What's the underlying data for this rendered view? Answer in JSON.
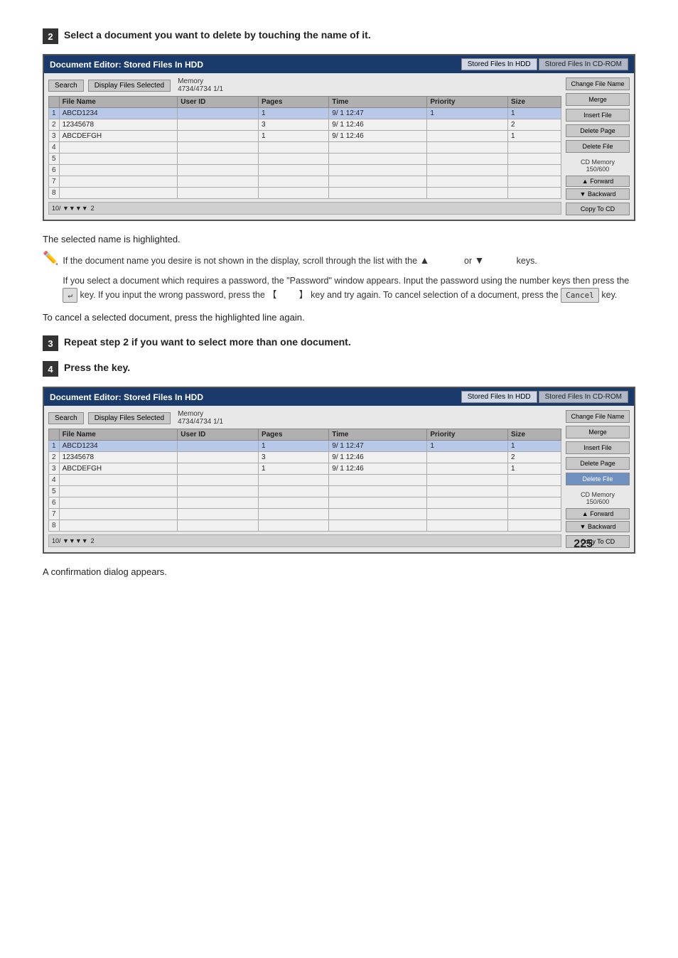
{
  "page": {
    "number": "225"
  },
  "step2": {
    "label": "2",
    "text": "Select a document you want to delete by touching the name of it."
  },
  "step3": {
    "label": "3",
    "text": "Repeat step 2 if you want to select more than one document."
  },
  "step4": {
    "label": "4",
    "text": "Press the                    key."
  },
  "editor1": {
    "title": "Document Editor: Stored Files In HDD",
    "tab1": "Stored Files In HDD",
    "tab2": "Stored Files In CD-ROM",
    "search_btn": "Search",
    "display_btn": "Display Files Selected",
    "memory_label": "Memory",
    "memory_used": "4734/",
    "memory_total": "4734",
    "page_info": "1/1",
    "columns": [
      "File Name",
      "User ID",
      "Pages",
      "Time",
      "Priority",
      "Size"
    ],
    "rows": [
      {
        "num": "1",
        "name": "ABCD1234",
        "user": "",
        "pages": "1",
        "time": "9/ 1 12:47",
        "priority": "1",
        "size": "1"
      },
      {
        "num": "2",
        "name": "12345678",
        "user": "",
        "pages": "3",
        "time": "9/ 1 12:46",
        "priority": "",
        "size": "2"
      },
      {
        "num": "3",
        "name": "ABCDEFGH",
        "user": "",
        "pages": "1",
        "time": "9/ 1 12:46",
        "priority": "",
        "size": "1"
      },
      {
        "num": "4",
        "name": "",
        "user": "",
        "pages": "",
        "time": "",
        "priority": "",
        "size": ""
      },
      {
        "num": "5",
        "name": "",
        "user": "",
        "pages": "",
        "time": "",
        "priority": "",
        "size": ""
      },
      {
        "num": "6",
        "name": "",
        "user": "",
        "pages": "",
        "time": "",
        "priority": "",
        "size": ""
      },
      {
        "num": "7",
        "name": "",
        "user": "",
        "pages": "",
        "time": "",
        "priority": "",
        "size": ""
      },
      {
        "num": "8",
        "name": "",
        "user": "",
        "pages": "",
        "time": "",
        "priority": "",
        "size": ""
      }
    ],
    "actions": {
      "change_file_name": "Change File Name",
      "merge": "Merge",
      "insert_file": "Insert File",
      "delete_page": "Delete Page",
      "delete_file": "Delete File",
      "cd_memory_label": "CD Memory",
      "cd_memory_used": "150/",
      "cd_memory_total": "600",
      "forward": "▲ Forward",
      "backward": "▼ Backward",
      "copy_to_cd": "Copy To CD"
    }
  },
  "editor2": {
    "title": "Document Editor: Stored Files In HDD",
    "tab1": "Stored Files In HDD",
    "tab2": "Stored Files In CD-ROM",
    "search_btn": "Search",
    "display_btn": "Display Files Selected",
    "memory_label": "Memory",
    "memory_used": "4734/",
    "memory_total": "4734",
    "page_info": "1/1",
    "columns": [
      "File Name",
      "User ID",
      "Pages",
      "Time",
      "Priority",
      "Size"
    ],
    "rows": [
      {
        "num": "1",
        "name": "ABCD1234",
        "user": "",
        "pages": "1",
        "time": "9/ 1 12:47",
        "priority": "1",
        "size": "1"
      },
      {
        "num": "2",
        "name": "12345678",
        "user": "",
        "pages": "3",
        "time": "9/ 1 12:46",
        "priority": "",
        "size": "2"
      },
      {
        "num": "3",
        "name": "ABCDEFGH",
        "user": "",
        "pages": "1",
        "time": "9/ 1 12:46",
        "priority": "",
        "size": "1"
      },
      {
        "num": "4",
        "name": "",
        "user": "",
        "pages": "",
        "time": "",
        "priority": "",
        "size": ""
      },
      {
        "num": "5",
        "name": "",
        "user": "",
        "pages": "",
        "time": "",
        "priority": "",
        "size": ""
      },
      {
        "num": "6",
        "name": "",
        "user": "",
        "pages": "",
        "time": "",
        "priority": "",
        "size": ""
      },
      {
        "num": "7",
        "name": "",
        "user": "",
        "pages": "",
        "time": "",
        "priority": "",
        "size": ""
      },
      {
        "num": "8",
        "name": "",
        "user": "",
        "pages": "",
        "time": "",
        "priority": "",
        "size": ""
      }
    ],
    "actions": {
      "change_file_name": "Change File Name",
      "merge": "Merge",
      "insert_file": "Insert File",
      "delete_page": "Delete Page",
      "delete_file": "Delete File",
      "cd_memory_label": "CD Memory",
      "cd_memory_used": "150/",
      "cd_memory_total": "600",
      "forward": "▲ Forward",
      "backward": "▼ Backward",
      "copy_to_cd": "Copy To CD"
    }
  },
  "desc1": "The selected name is highlighted.",
  "desc2": "A confirmation dialog appears.",
  "note": {
    "line1": "If the document name you desire is not shown in the display, scroll through the list with the ▲               or ▼               keys.",
    "line2": "If you select a document which requires a password, the \"Password\" window appears. Input the password using the number keys then press the       key. If you input the wrong password, press the 【      】key and try again. To cancel selection of a document, press the              key."
  },
  "cancel_line": "To cancel a selected document, press the highlighted line again.",
  "or_text": "or"
}
